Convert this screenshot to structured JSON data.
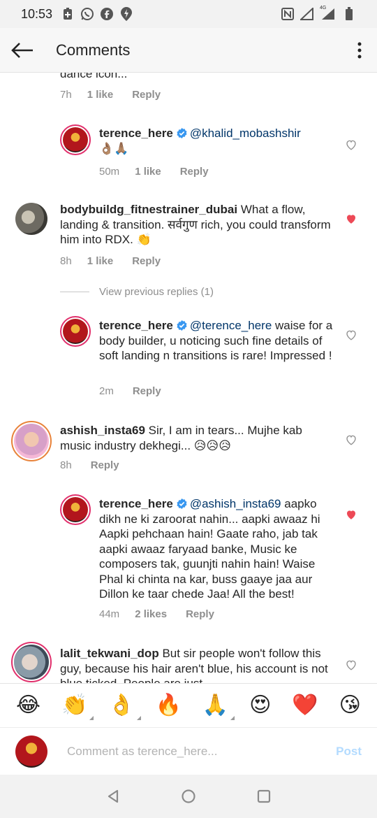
{
  "status_bar": {
    "time": "10:53",
    "network_label": "4G"
  },
  "header": {
    "title": "Comments"
  },
  "comments": [
    {
      "text": "dance icon...",
      "time": "7h",
      "likes": "1 like",
      "reply": "Reply"
    },
    {
      "username": "terence_here",
      "verified": true,
      "mention": "@khalid_mobashshir",
      "text": "👌🏽🙏🏽",
      "time": "50m",
      "likes": "1 like",
      "reply": "Reply",
      "liked": false
    },
    {
      "username": "bodybuildg_fitnestrainer_dubai",
      "text": "What a flow, landing & transition. सर्वगुण rich, you could transform him into RDX. 👏",
      "time": "8h",
      "likes": "1 like",
      "reply": "Reply",
      "liked": true
    },
    {
      "view_previous": "View previous replies (1)"
    },
    {
      "username": "terence_here",
      "verified": true,
      "mention": "@terence_here",
      "text": "waise for a body builder,  u noticing such fine details of soft landing n transitions is rare! Impressed !",
      "time": "2m",
      "reply": "Reply",
      "liked": false
    },
    {
      "username": "ashish_insta69",
      "text": "Sir, I am in tears... Mujhe kab music industry dekhegi... 😥😥😥",
      "time": "8h",
      "reply": "Reply",
      "liked": false
    },
    {
      "username": "terence_here",
      "verified": true,
      "mention": "@ashish_insta69",
      "text": "aapko dikh ne ki zaroorat nahin... aapki awaaz hi Aapki pehchaan hain! Gaate raho, jab tak aapki awaaz faryaad banke, Music ke composers tak, guunjti nahin hain! Waise Phal ki chinta na kar, buss gaaye jaa aur Dillon ke taar chede Jaa! All the best!",
      "time": "44m",
      "likes": "2 likes",
      "reply": "Reply",
      "liked": true
    },
    {
      "username": "lalit_tekwani_dop",
      "text": "But sir people won't follow this guy, because his hair aren't blue, his account is not blue ticked. People are just",
      "liked": false
    }
  ],
  "emoji_bar": [
    "😂",
    "👏",
    "👌",
    "🔥",
    "🙏",
    "😍",
    "❤️",
    "😘"
  ],
  "composer": {
    "placeholder": "Comment as terence_here...",
    "post_label": "Post"
  },
  "colors": {
    "like_red": "#ed4956",
    "mention_blue": "#003569",
    "verified_blue": "#3897f0",
    "post_disabled": "#b3dbff"
  }
}
